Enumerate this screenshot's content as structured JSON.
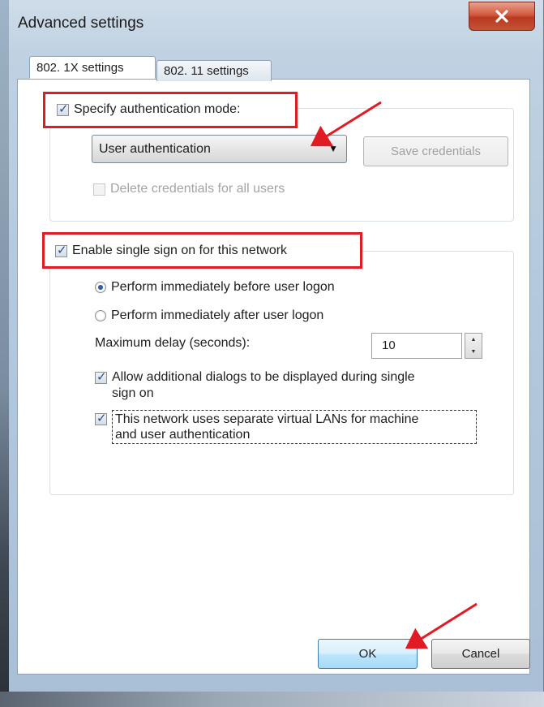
{
  "window": {
    "title": "Advanced settings"
  },
  "tabs": [
    {
      "label": "802. 1X settings",
      "active": true
    },
    {
      "label": "802. 11 settings",
      "active": false
    }
  ],
  "auth": {
    "specify_mode_label": "Specify authentication mode:",
    "specify_mode_checked": true,
    "mode_value": "User authentication",
    "save_credentials_label": "Save credentials",
    "delete_credentials_label": "Delete credentials for all users",
    "delete_credentials_checked": false
  },
  "sso": {
    "enable_label": "Enable single sign on for this network",
    "enable_checked": true,
    "before_logon_label": "Perform immediately before user logon",
    "before_logon_selected": true,
    "after_logon_label": "Perform immediately after user logon",
    "after_logon_selected": false,
    "max_delay_label": "Maximum delay (seconds):",
    "max_delay_value": "10",
    "allow_dialogs_line1": "Allow additional dialogs to be displayed during single",
    "allow_dialogs_line2": "sign on",
    "allow_dialogs_checked": true,
    "vlan_line1": "This network uses separate virtual LANs for machine",
    "vlan_line2": "and user authentication",
    "vlan_checked": true
  },
  "footer": {
    "ok_label": "OK",
    "cancel_label": "Cancel"
  },
  "colors": {
    "annotation_red": "#e01b24",
    "close_red": "#c4533a"
  },
  "icons": {
    "close": "close-icon",
    "dropdown": "chevron-down-icon",
    "spin": "spin-up-down-icon"
  }
}
